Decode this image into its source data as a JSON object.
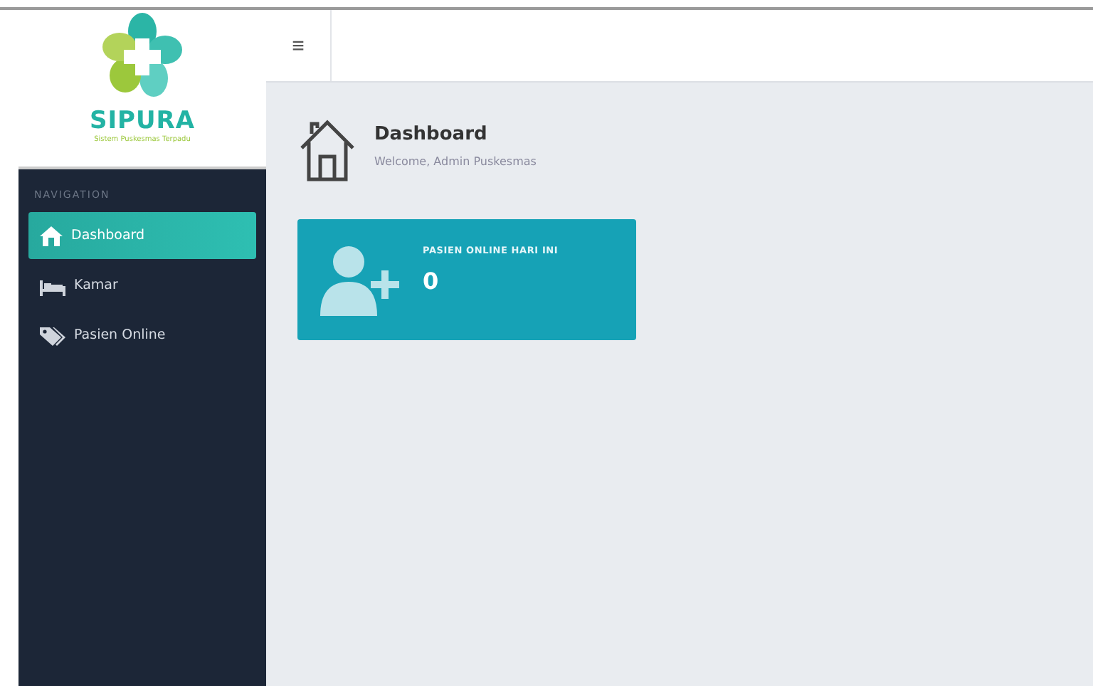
{
  "brand": {
    "name": "SIPURA",
    "tagline": "Sistem Puskesmas Terpadu"
  },
  "topbar": {
    "menu_button": "≡"
  },
  "sidebar": {
    "heading": "NAVIGATION",
    "items": [
      {
        "label": "Dashboard",
        "kind": "home",
        "selected": true
      },
      {
        "label": "Kamar",
        "kind": "bed",
        "selected": false
      },
      {
        "label": "Pasien Online",
        "kind": "tag",
        "selected": false
      }
    ]
  },
  "page": {
    "title": "Dashboard",
    "subtitle": "Welcome, Admin Puskesmas"
  },
  "cards": [
    {
      "label": "PASIEN ONLINE HARI INI",
      "value": "0"
    }
  ]
}
